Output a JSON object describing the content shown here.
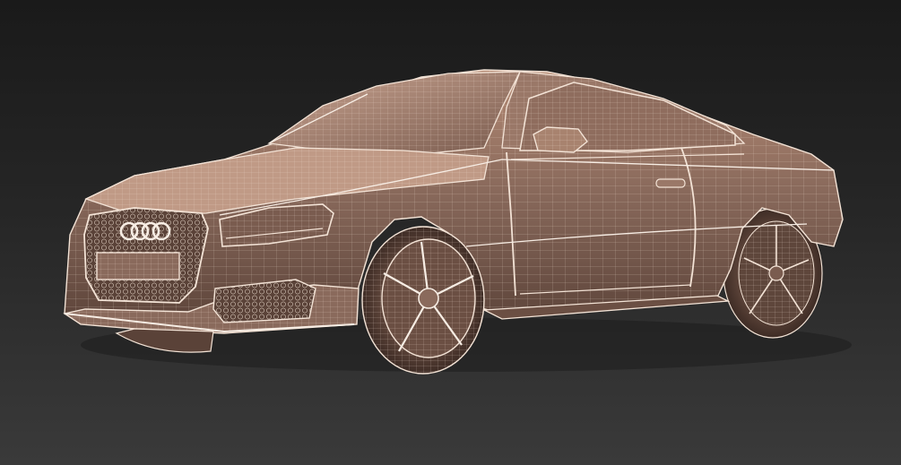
{
  "scene": {
    "subject": "car-wireframe-render",
    "colors": {
      "background_top": "#1a1a1a",
      "background_bottom": "#3a3a3a",
      "body_shaded": "#8a6a5c",
      "body_dark": "#4a352d",
      "body_light": "#c9a491",
      "wire": "#f3e3d6"
    }
  }
}
